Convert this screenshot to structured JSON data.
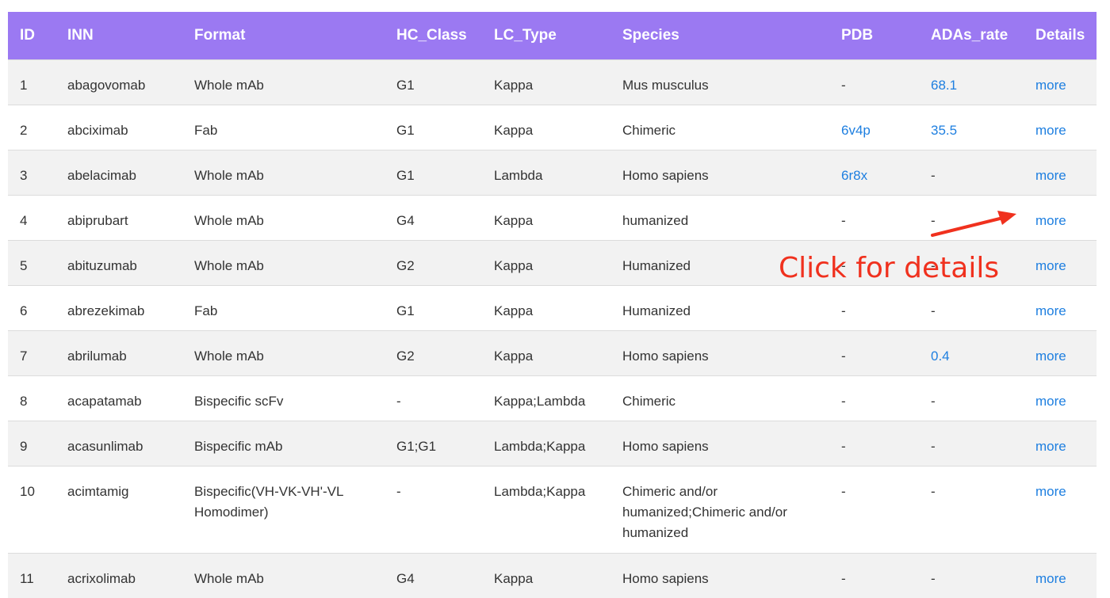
{
  "table": {
    "headers": {
      "id": "ID",
      "inn": "INN",
      "format": "Format",
      "hc_class": "HC_Class",
      "lc_type": "LC_Type",
      "species": "Species",
      "pdb": "PDB",
      "ada": "ADAs_rate",
      "details": "Details"
    },
    "rows": [
      {
        "id": "1",
        "inn": "abagovomab",
        "format": "Whole mAb",
        "hc": "G1",
        "lc": "Kappa",
        "species": "Mus musculus",
        "pdb": "-",
        "ada": "68.1",
        "details": "more"
      },
      {
        "id": "2",
        "inn": "abciximab",
        "format": "Fab",
        "hc": "G1",
        "lc": "Kappa",
        "species": "Chimeric",
        "pdb": "6v4p",
        "ada": "35.5",
        "details": "more"
      },
      {
        "id": "3",
        "inn": "abelacimab",
        "format": "Whole mAb",
        "hc": "G1",
        "lc": "Lambda",
        "species": "Homo sapiens",
        "pdb": "6r8x",
        "ada": "-",
        "details": "more"
      },
      {
        "id": "4",
        "inn": "abiprubart",
        "format": "Whole mAb",
        "hc": "G4",
        "lc": "Kappa",
        "species": "humanized",
        "pdb": "-",
        "ada": "-",
        "details": "more"
      },
      {
        "id": "5",
        "inn": "abituzumab",
        "format": "Whole mAb",
        "hc": "G2",
        "lc": "Kappa",
        "species": "Humanized",
        "pdb": "-",
        "ada": "-",
        "details": "more"
      },
      {
        "id": "6",
        "inn": "abrezekimab",
        "format": "Fab",
        "hc": "G1",
        "lc": "Kappa",
        "species": "Humanized",
        "pdb": "-",
        "ada": "-",
        "details": "more"
      },
      {
        "id": "7",
        "inn": "abrilumab",
        "format": "Whole mAb",
        "hc": "G2",
        "lc": "Kappa",
        "species": "Homo sapiens",
        "pdb": "-",
        "ada": "0.4",
        "details": "more"
      },
      {
        "id": "8",
        "inn": "acapatamab",
        "format": "Bispecific scFv",
        "hc": "-",
        "lc": "Kappa;Lambda",
        "species": "Chimeric",
        "pdb": "-",
        "ada": "-",
        "details": "more"
      },
      {
        "id": "9",
        "inn": "acasunlimab",
        "format": "Bispecific mAb",
        "hc": "G1;G1",
        "lc": "Lambda;Kappa",
        "species": "Homo sapiens",
        "pdb": "-",
        "ada": "-",
        "details": "more"
      },
      {
        "id": "10",
        "inn": "acimtamig",
        "format": "Bispecific(VH-VK-VH'-VL Homodimer)",
        "hc": "-",
        "lc": "Lambda;Kappa",
        "species": "Chimeric and/or humanized;Chimeric and/or humanized",
        "pdb": "-",
        "ada": "-",
        "details": "more"
      },
      {
        "id": "11",
        "inn": "acrixolimab",
        "format": "Whole mAb",
        "hc": "G4",
        "lc": "Kappa",
        "species": "Homo sapiens",
        "pdb": "-",
        "ada": "-",
        "details": "more"
      }
    ]
  },
  "annotation": {
    "text": "Click for details",
    "color": "#f0311e"
  },
  "colors": {
    "header_bg": "#9b79f2",
    "link": "#1e7fe0",
    "row_alt": "#f2f2f2"
  }
}
